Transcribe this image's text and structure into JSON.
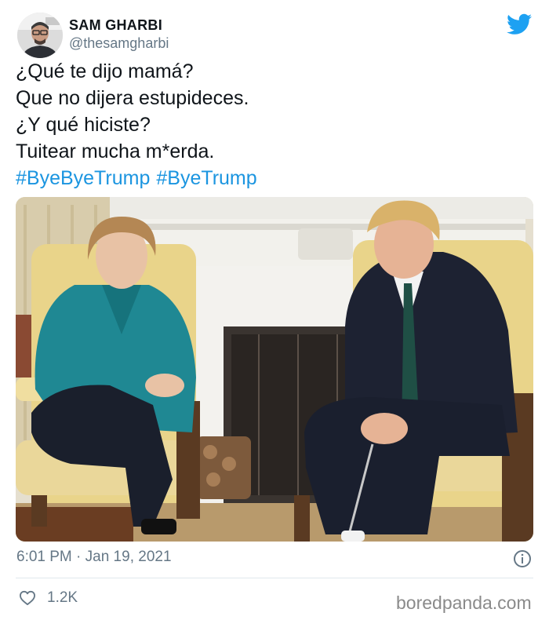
{
  "author": {
    "name": "SAM GHARBI",
    "handle": "@thesamgharbi"
  },
  "tweet": {
    "lines": [
      "¿Qué te dijo mamá?",
      "Que no dijera estupideces.",
      "¿Y qué hiciste?",
      "Tuitear mucha m*erda."
    ],
    "hashtags": [
      "#ByeByeTrump",
      "#ByeTrump"
    ]
  },
  "meta": {
    "timestamp": "6:01 PM · Jan 19, 2021"
  },
  "engagement": {
    "likes": "1.2K"
  },
  "watermark": "boredpanda.com",
  "icons": {
    "brand": "twitter-bird-icon",
    "info": "info-icon",
    "like": "heart-icon"
  },
  "colors": {
    "accent": "#1da1f2",
    "hashtag": "#1b95e0",
    "muted": "#657786",
    "divider": "#e1e8ed"
  }
}
